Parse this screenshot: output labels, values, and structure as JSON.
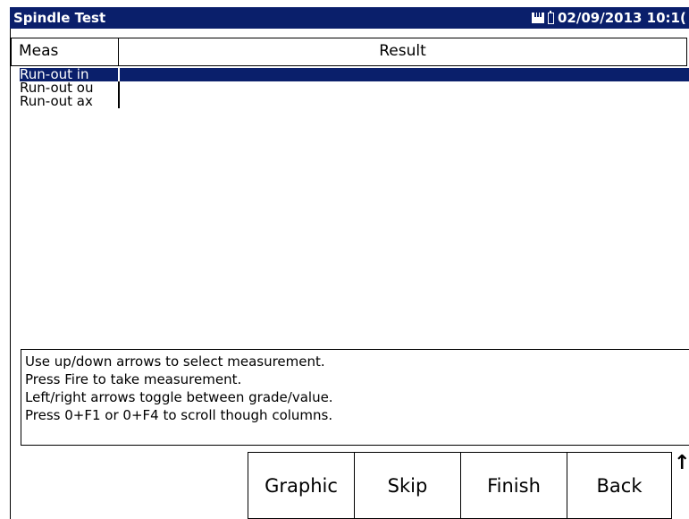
{
  "window": {
    "title": "Spindle Test",
    "datetime": "02/09/2013 10:1(",
    "status_icons": [
      "sd-card-icon",
      "battery-icon"
    ]
  },
  "table": {
    "columns": [
      "Meas",
      "Result"
    ],
    "rows": [
      {
        "meas": "Run-out in",
        "result": "",
        "selected": true
      },
      {
        "meas": "Run-out ou",
        "result": "",
        "selected": false
      },
      {
        "meas": "Run-out ax",
        "result": "",
        "selected": false
      }
    ]
  },
  "help": {
    "lines": [
      "Use up/down arrows to select measurement.",
      "Press Fire to take measurement.",
      "Left/right arrows toggle between grade/value.",
      "Press 0+F1 or 0+F4 to scroll though columns."
    ]
  },
  "buttons": {
    "graphic": "Graphic",
    "skip": "Skip",
    "finish": "Finish",
    "back": "Back"
  },
  "scroll_indicator": "↑",
  "colors": {
    "title_bar": "#0a1f6b",
    "selection": "#0a1f6b"
  }
}
